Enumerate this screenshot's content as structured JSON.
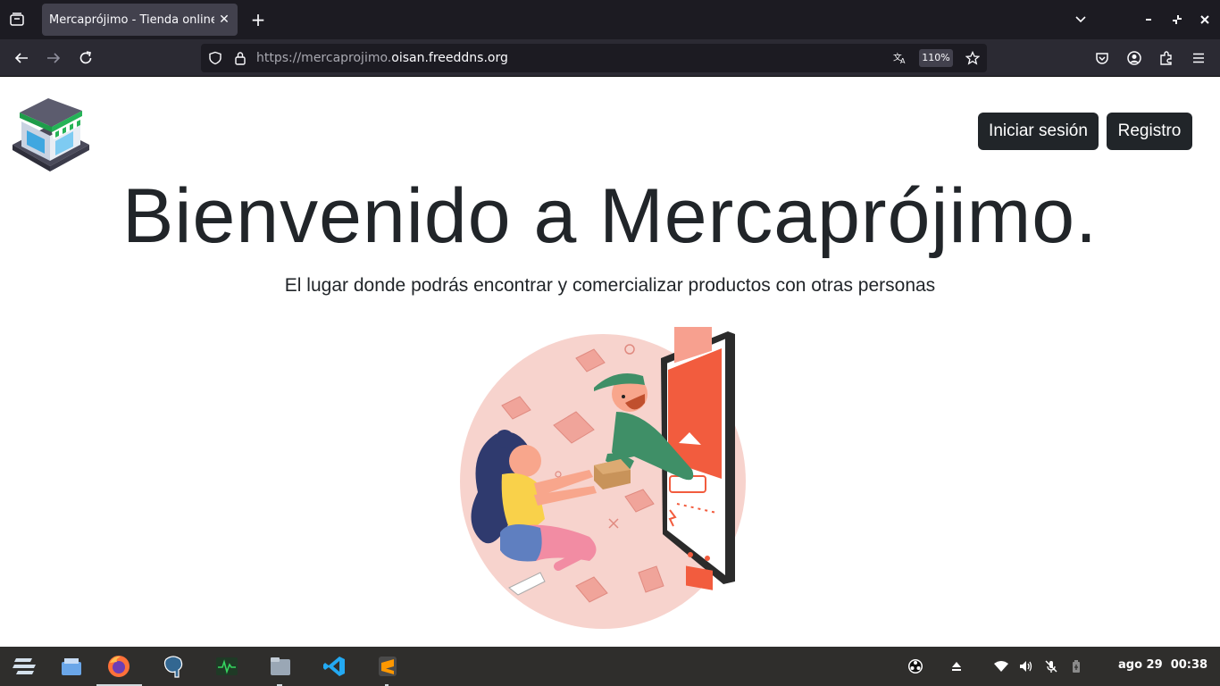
{
  "browser": {
    "tab": {
      "title": "Mercaprójimo - Tienda online"
    },
    "url": {
      "prefix": "https://mercaprojimo.",
      "domain": "oisan.freeddns.org"
    },
    "zoom": "110%"
  },
  "page": {
    "login_label": "Iniciar sesión",
    "register_label": "Registro",
    "title": "Bienvenido a Mercaprójimo.",
    "subtitle": "El lugar donde podrás encontrar y comercializar productos con otras personas"
  },
  "taskbar": {
    "date": "ago 29",
    "time": "00:38"
  },
  "colors": {
    "browser_tabbar": "#1c1b22",
    "browser_toolbar": "#2b2a33",
    "button_dark": "#212529",
    "illustration_blob": "#f7d3cd",
    "accent_orange": "#f25c3e",
    "taskbar": "#2f2e2c"
  },
  "icons": [
    "tab-list-icon",
    "close-icon",
    "plus-icon",
    "chevron-down-icon",
    "minimize-icon",
    "restore-icon",
    "back-icon",
    "forward-icon",
    "reload-icon",
    "shield-icon",
    "lock-icon",
    "translate-icon",
    "star-icon",
    "pocket-icon",
    "account-icon",
    "extensions-icon",
    "menu-icon",
    "zorin-menu-icon",
    "files-icon",
    "firefox-icon",
    "postgresql-icon",
    "system-monitor-icon",
    "file-manager-icon",
    "vscode-icon",
    "sublime-icon",
    "obs-icon",
    "eject-icon",
    "wifi-icon",
    "volume-icon",
    "mic-muted-icon",
    "battery-icon"
  ]
}
